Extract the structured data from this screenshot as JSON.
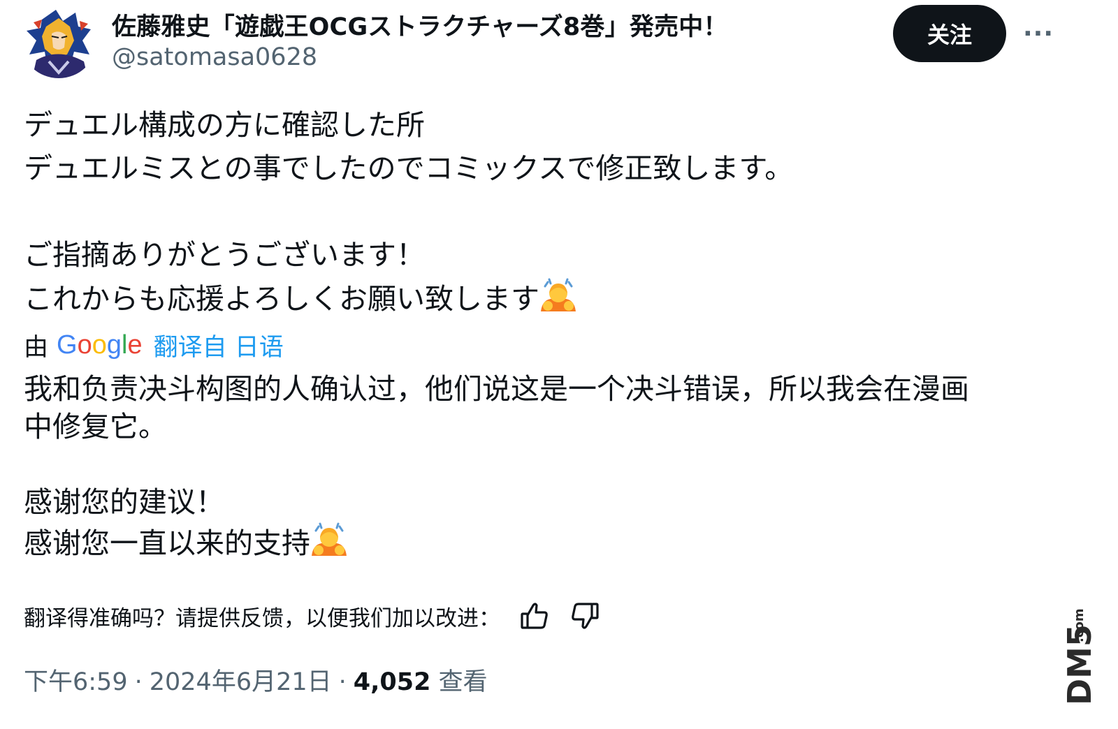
{
  "author": {
    "display_name": "佐藤雅史「遊戯王OCGストラクチャーズ8巻」発売中！",
    "handle": "@satomasa0628",
    "avatar_icon": "avatar-image"
  },
  "actions": {
    "follow_label": "关注",
    "more_label": "···"
  },
  "original": {
    "line1": "デュエル構成の方に確認した所",
    "line2": "デュエルミスとの事でしたのでコミックスで修正致します。",
    "line3": "ご指摘ありがとうございます！",
    "line4": "これからも応援よろしくお願い致します",
    "emoji": "person-bowing-emoji"
  },
  "translation_info": {
    "by": "由",
    "google": [
      "G",
      "o",
      "o",
      "g",
      "l",
      "e"
    ],
    "link": "翻译自 日语"
  },
  "translation": {
    "line1": "我和负责决斗构图的人确认过，他们说这是一个决斗错误，所以我会在漫画",
    "line2": "中修复它。",
    "line3": "感谢您的建议！",
    "line4": "感谢您一直以来的支持",
    "emoji": "person-bowing-emoji"
  },
  "feedback": {
    "question": "翻译得准确吗？请提供反馈，以便我们加以改进：",
    "thumbs_up_icon": "thumbs-up-icon",
    "thumbs_down_icon": "thumbs-down-icon"
  },
  "meta": {
    "time": "下午6:59",
    "separator": "·",
    "date": "2024年6月21日",
    "views_count": "4,052",
    "views_label": "查看"
  },
  "watermark": {
    "text": "DM5",
    "suffix": ".com"
  },
  "colors": {
    "text": "#0f1419",
    "secondary": "#536471",
    "link": "#1d9bf0",
    "button_bg": "#0f1419"
  }
}
